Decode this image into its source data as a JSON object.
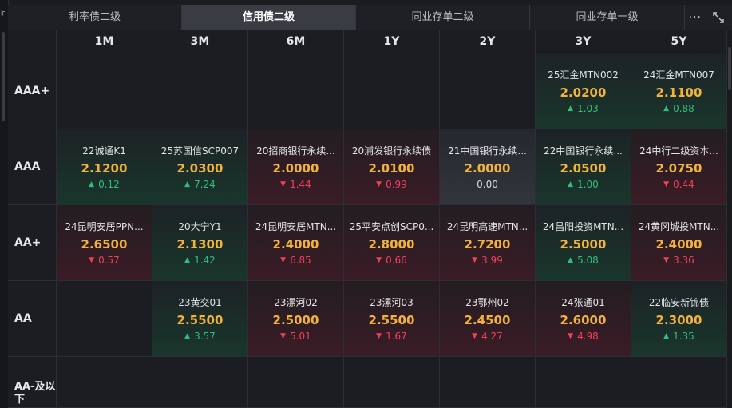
{
  "tabs": [
    {
      "label": "利率债二级",
      "width": 218,
      "active": false
    },
    {
      "label": "信用债二级",
      "width": 218,
      "active": true
    },
    {
      "label": "同业存单二级",
      "width": 218,
      "active": false
    },
    {
      "label": "同业存单一级",
      "width": 194,
      "active": false
    }
  ],
  "actions": {
    "more": "···",
    "more_icon": "more-icon",
    "expand_icon": "expand-icon"
  },
  "left_glyph": "╔",
  "columns": [
    "1M",
    "3M",
    "6M",
    "1Y",
    "2Y",
    "3Y",
    "5Y"
  ],
  "rows": [
    {
      "label": "AAA+",
      "cells": [
        null,
        null,
        null,
        null,
        null,
        {
          "name": "25汇金MTN002",
          "yield": "2.0200",
          "change": "1.03",
          "dir": "up"
        },
        {
          "name": "24汇金MTN007",
          "yield": "2.1100",
          "change": "0.88",
          "dir": "up"
        }
      ]
    },
    {
      "label": "AAA",
      "cells": [
        {
          "name": "22诚通K1",
          "yield": "2.1200",
          "change": "0.12",
          "dir": "up"
        },
        {
          "name": "25苏国信SCP007",
          "yield": "2.0300",
          "change": "7.24",
          "dir": "up"
        },
        {
          "name": "20招商银行永续...",
          "yield": "2.0000",
          "change": "1.44",
          "dir": "down"
        },
        {
          "name": "20浦发银行永续债",
          "yield": "2.0100",
          "change": "0.99",
          "dir": "down"
        },
        {
          "name": "21中国银行永续...",
          "yield": "2.0000",
          "change": "0.00",
          "dir": "flat"
        },
        {
          "name": "22中国银行永续...",
          "yield": "2.0500",
          "change": "1.00",
          "dir": "up"
        },
        {
          "name": "24中行二级资本...",
          "yield": "2.0750",
          "change": "0.44",
          "dir": "down"
        }
      ]
    },
    {
      "label": "AA+",
      "cells": [
        {
          "name": "24昆明安居PPN...",
          "yield": "2.6500",
          "change": "0.57",
          "dir": "down"
        },
        {
          "name": "20大宁Y1",
          "yield": "2.1300",
          "change": "1.42",
          "dir": "up"
        },
        {
          "name": "24昆明安居MTN...",
          "yield": "2.4000",
          "change": "6.85",
          "dir": "down"
        },
        {
          "name": "25平安点创SCP0...",
          "yield": "2.8000",
          "change": "0.66",
          "dir": "down"
        },
        {
          "name": "24昆明高速MTN...",
          "yield": "2.7200",
          "change": "3.99",
          "dir": "down"
        },
        {
          "name": "24昌阳投资MTN...",
          "yield": "2.5000",
          "change": "5.08",
          "dir": "up"
        },
        {
          "name": "24黄冈城投MTN...",
          "yield": "2.4000",
          "change": "3.36",
          "dir": "down"
        }
      ]
    },
    {
      "label": "AA",
      "cells": [
        null,
        {
          "name": "23黄交01",
          "yield": "2.5500",
          "change": "3.57",
          "dir": "up"
        },
        {
          "name": "23漯河02",
          "yield": "2.5000",
          "change": "5.01",
          "dir": "down"
        },
        {
          "name": "23漯河03",
          "yield": "2.5500",
          "change": "1.67",
          "dir": "down"
        },
        {
          "name": "23鄂州02",
          "yield": "2.4500",
          "change": "4.27",
          "dir": "down"
        },
        {
          "name": "24张通01",
          "yield": "2.6000",
          "change": "4.98",
          "dir": "down"
        },
        {
          "name": "22临安新锦债",
          "yield": "2.3000",
          "change": "1.35",
          "dir": "up"
        }
      ]
    },
    {
      "label": "AA-及以下",
      "cells": [
        null,
        null,
        null,
        null,
        null,
        null,
        null
      ]
    }
  ],
  "colors": {
    "accent_yield": "#f2b33c",
    "up": "#2fbf7a",
    "down": "#f2405a",
    "bg": "#1b1c20"
  }
}
